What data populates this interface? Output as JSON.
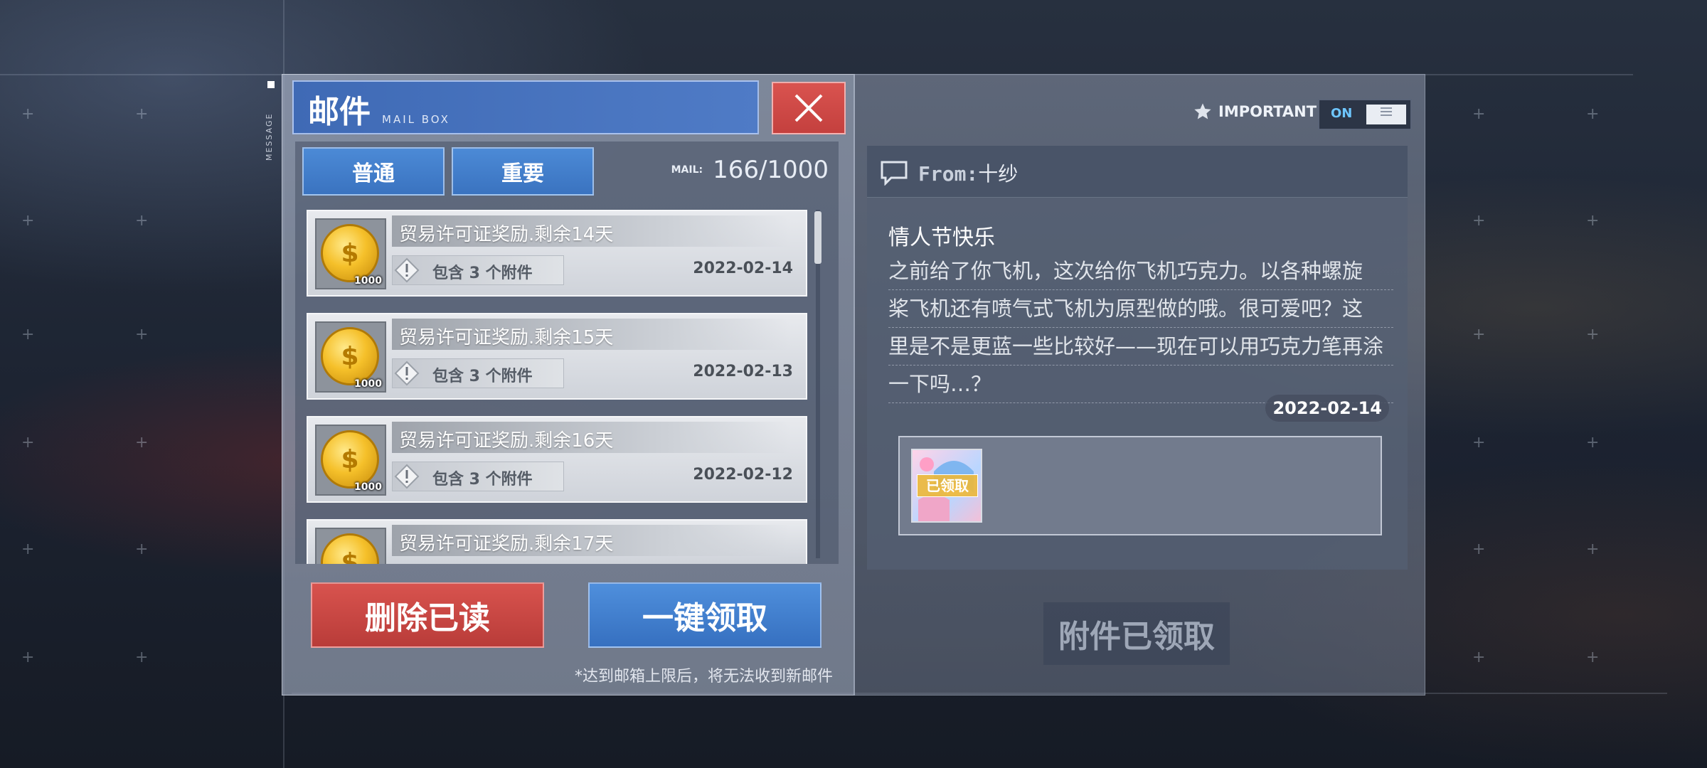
{
  "side_tag": "MESSAGE",
  "mailbox": {
    "title_cn": "邮件",
    "title_en": "MAIL BOX",
    "tabs": [
      {
        "label": "普通"
      },
      {
        "label": "重要"
      }
    ],
    "mail_count_label": "MAIL:",
    "mail_count": "166/1000",
    "items": [
      {
        "title": "贸易许可证奖励.剩余14天",
        "attachments": "包含 3 个附件",
        "date": "2022-02-14",
        "qty": "1000",
        "icon": "gold-coin-icon"
      },
      {
        "title": "贸易许可证奖励.剩余15天",
        "attachments": "包含 3 个附件",
        "date": "2022-02-13",
        "qty": "1000",
        "icon": "gold-coin-icon"
      },
      {
        "title": "贸易许可证奖励.剩余16天",
        "attachments": "包含 3 个附件",
        "date": "2022-02-12",
        "qty": "1000",
        "icon": "gold-coin-icon"
      },
      {
        "title": "贸易许可证奖励.剩余17天",
        "attachments": "",
        "date": "",
        "qty": "",
        "icon": "gold-coin-icon"
      }
    ],
    "delete_read_label": "删除已读",
    "claim_all_label": "一键领取",
    "footnote": "*达到邮箱上限后，将无法收到新邮件"
  },
  "detail": {
    "important_label": "IMPORTANT",
    "toggle_label": "ON",
    "from_label": "From:",
    "from_name": "十纱",
    "subject": "情人节快乐",
    "body_lines": [
      "之前给了你飞机，这次给你飞机巧克力。以各种螺旋",
      "桨飞机还有喷气式飞机为原型做的哦。很可爱吧？这",
      "里是不是更蓝一些比较好——现在可以用巧克力笔再涂",
      "一下吗…？"
    ],
    "date": "2022-02-14",
    "claimed_badge": "已领取",
    "claimed_button": "附件已领取"
  },
  "colors": {
    "accent_blue": "#3f6ab5",
    "delete_red": "#c4403e",
    "close_red": "#d9534f"
  }
}
